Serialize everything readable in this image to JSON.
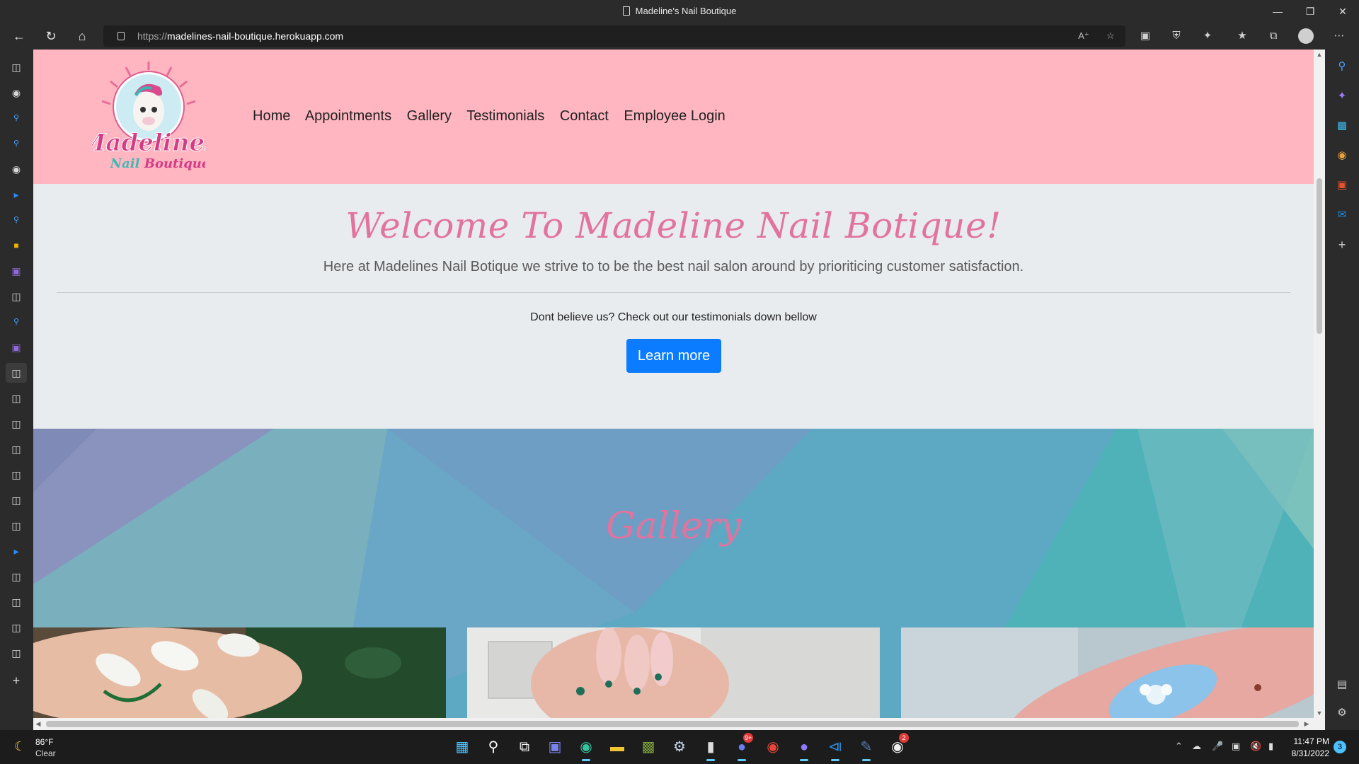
{
  "window": {
    "title": "Madeline's Nail Boutique"
  },
  "browser": {
    "url_protocol": "https://",
    "url_host": "madelines-nail-boutique.herokuapp.com"
  },
  "site": {
    "logo_text": "Madelines Nail Boutique",
    "nav": [
      "Home",
      "Appointments",
      "Gallery",
      "Testimonials",
      "Contact",
      "Employee Login"
    ],
    "jumbotron": {
      "headline": "Welcome To Madeline Nail Botique!",
      "lead": "Here at Madelines Nail Botique we strive to to be the best nail salon around by prioriticing customer satisfaction.",
      "sub": "Dont believe us? Check out our testimonials down bellow",
      "button": "Learn more"
    },
    "gallery": {
      "title": "Gallery"
    }
  },
  "colors": {
    "header_bg": "#ffb6c1",
    "jumbo_bg": "#e9ecef",
    "accent_pink": "#e2739f",
    "button_blue": "#0b7bff"
  },
  "taskbar": {
    "weather_temp": "86°F",
    "weather_cond": "Clear",
    "time": "11:47 PM",
    "date": "8/31/2022",
    "notifications": "3",
    "discord_badge": "9+",
    "app_badge": "2"
  }
}
